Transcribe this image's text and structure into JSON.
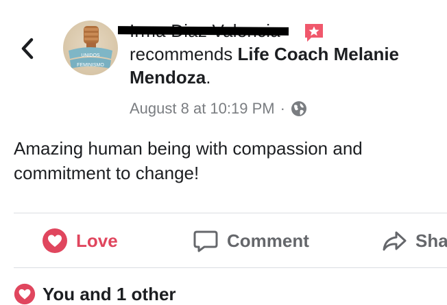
{
  "header": {
    "author_name": "Irma Diaz Valencia",
    "recommends_text": "recommends",
    "page_name": "Life Coach Melanie Mendoza",
    "period": ".",
    "timestamp": "August 8 at 10:19 PM",
    "separator": "·",
    "avatar_text": [
      "UNIDOS",
      "FEMINISMO"
    ]
  },
  "post": {
    "body": "Amazing human being with compassion and commitment to change!"
  },
  "actions": {
    "love_label": "Love",
    "comment_label": "Comment",
    "share_label": "Sha"
  },
  "reactions": {
    "summary": "You and 1 other"
  },
  "colors": {
    "love": "#e0465e",
    "badge": "#f0586c",
    "muted": "#65676b",
    "timestamp": "#7a7d81",
    "divider": "#dadde1"
  },
  "icons": [
    "back-chevron-icon",
    "recommend-star-icon",
    "globe-icon",
    "love-heart-icon",
    "comment-icon",
    "share-icon"
  ]
}
